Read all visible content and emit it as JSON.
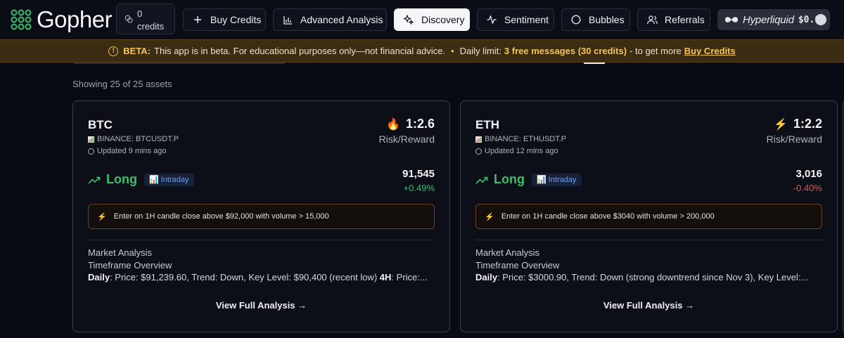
{
  "app": {
    "name": "Gopher"
  },
  "credits": {
    "count": "0",
    "label": "credits"
  },
  "nav": [
    {
      "label": "Buy Credits",
      "icon": "plus-icon"
    },
    {
      "label": "Advanced Analysis",
      "icon": "bar-chart-icon"
    },
    {
      "label": "Discovery",
      "icon": "sparkles-icon",
      "active": true
    },
    {
      "label": "Sentiment",
      "icon": "pulse-icon"
    },
    {
      "label": "Bubbles",
      "icon": "circle-icon"
    },
    {
      "label": "Referrals",
      "icon": "users-icon"
    }
  ],
  "wallet": {
    "name": "Hyperliquid",
    "balance": "$0.0",
    "icon": "hyperliquid-logo"
  },
  "banner": {
    "tag": "BETA:",
    "text": "This app is in beta.  For educational purposes only—not financial advice.",
    "limit_prefix": "Daily limit:",
    "limit_bold": "3 free messages (30 credits)",
    "limit_suffix": "- to get more",
    "link": "Buy Credits",
    "colors": {
      "accent": "#f6c35a",
      "background": "#3a2d14"
    }
  },
  "results": {
    "showing": "Showing 25 of 25 assets"
  },
  "assets": [
    {
      "symbol": "BTC",
      "exchange": "BINANCE: BTCUSDT.P",
      "updated": "Updated 9 mins ago",
      "rr_icon": "fire-icon",
      "rr_glyph": "🔥",
      "rr": "1:2.6",
      "rr_label": "Risk/Reward",
      "direction": "Long",
      "timeframe": "Intraday",
      "price": "91,545",
      "change": "+0.49%",
      "change_dir": "up",
      "entry": "Enter on 1H candle close above $92,000 with volume > 15,000",
      "section_title": "Market Analysis",
      "subtitle": "Timeframe Overview",
      "daily_label": "Daily",
      "daily_text": ": Price: $91,239.60, Trend: Down, Key Level: $90,400 (recent low) ",
      "h4_label": "4H",
      "h4_text": ": Price:...",
      "cta": "View Full Analysis →"
    },
    {
      "symbol": "ETH",
      "exchange": "BINANCE: ETHUSDT.P",
      "updated": "Updated 12 mins ago",
      "rr_icon": "bolt-icon",
      "rr_glyph": "⚡",
      "rr": "1:2.2",
      "rr_label": "Risk/Reward",
      "direction": "Long",
      "timeframe": "Intraday",
      "price": "3,016",
      "change": "-0.40%",
      "change_dir": "down",
      "entry": "Enter on 1H candle close above $3040 with volume > 200,000",
      "section_title": "Market Analysis",
      "subtitle": "Timeframe Overview",
      "daily_label": "Daily",
      "daily_text": ": Price: $3000.90, Trend: Down (strong downtrend since Nov 3), Key Level:...",
      "h4_label": "",
      "h4_text": "",
      "cta": "View Full Analysis →"
    }
  ]
}
